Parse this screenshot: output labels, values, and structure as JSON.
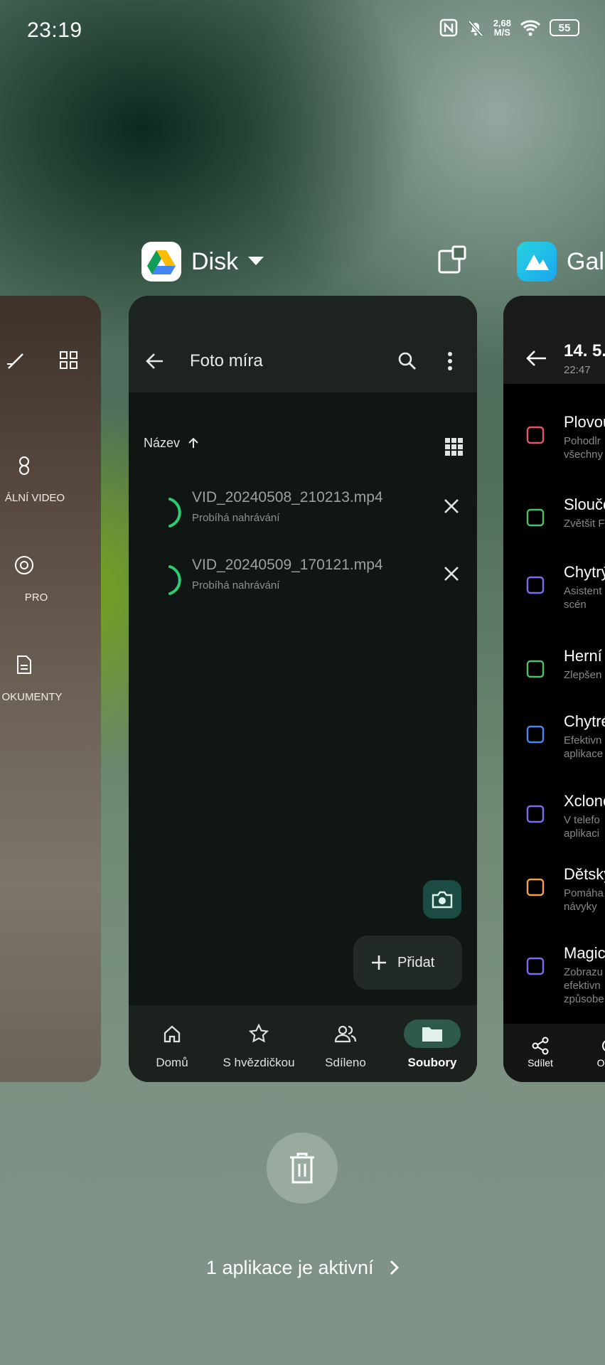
{
  "status_bar": {
    "time": "23:19",
    "net_speed_value": "2,68",
    "net_speed_unit": "M/S",
    "battery": "55"
  },
  "center_app": {
    "name": "Disk"
  },
  "right_app": {
    "name": "Gale"
  },
  "left_card": {
    "modes": [
      "ÁLNÍ VIDEO",
      "PRO",
      "OKUMENTY"
    ]
  },
  "drive": {
    "folder_title": "Foto míra",
    "sort_label": "Název",
    "files": [
      {
        "name": "VID_20240508_210213.mp4",
        "status": "Probíhá nahrávání"
      },
      {
        "name": "VID_20240509_170121.mp4",
        "status": "Probíhá nahrávání"
      }
    ],
    "add_label": "Přidat",
    "nav": [
      {
        "label": "Domů",
        "icon": "home-icon"
      },
      {
        "label": "S hvězdičkou",
        "icon": "star-icon"
      },
      {
        "label": "Sdíleno",
        "icon": "shared-icon"
      },
      {
        "label": "Soubory",
        "icon": "folder-icon"
      }
    ]
  },
  "gallery": {
    "date": "14. 5.",
    "time": "22:47",
    "features": [
      {
        "title": "Plovou",
        "sub": [
          "Pohodlr",
          "všechny"
        ],
        "icon": "floating-window-icon",
        "color": "#e5566a"
      },
      {
        "title": "Slouče",
        "sub": [
          "Zvětšit F"
        ],
        "icon": "save-icon",
        "color": "#4fbf6a"
      },
      {
        "title": "Chytrý",
        "sub": [
          "Asistent",
          "scén"
        ],
        "icon": "sidebar-icon",
        "color": "#7b6cf0"
      },
      {
        "title": "Herní",
        "sub": [
          "Zlepšen"
        ],
        "icon": "gamepad-icon",
        "color": "#4fbf6a"
      },
      {
        "title": "Chytré",
        "sub": [
          "Efektivn",
          "aplikace"
        ],
        "icon": "layers-icon",
        "color": "#4a86f0"
      },
      {
        "title": "Xclone",
        "sub": [
          "V telefo",
          "aplikaci"
        ],
        "icon": "clone-icon",
        "color": "#7b6cf0"
      },
      {
        "title": "Dětský",
        "sub": [
          "Pomáha",
          "návyky"
        ],
        "icon": "kid-icon",
        "color": "#f0a24a"
      },
      {
        "title": "Magic",
        "sub": [
          "Zobrazu",
          "efektivn",
          "způsobe"
        ],
        "icon": "window-icon",
        "color": "#7b6cf0"
      }
    ],
    "bottom": [
      "Sdílet",
      "Ob"
    ]
  },
  "footer": {
    "active_apps": "1 aplikace je aktivní"
  },
  "colors": {
    "accent_green": "#2ecc71",
    "fab_green": "#1b4b42",
    "nav_active": "#2d5a4c"
  }
}
